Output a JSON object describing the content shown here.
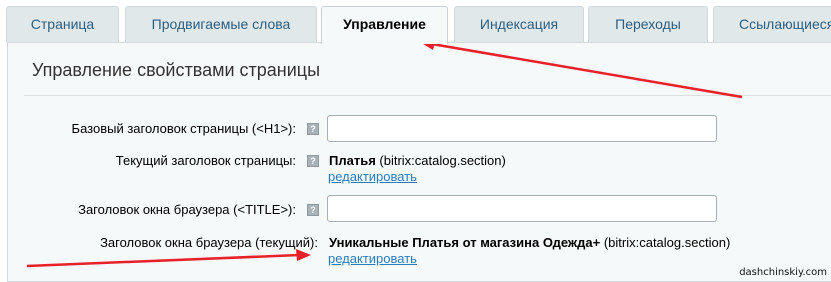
{
  "tabs": [
    {
      "label": "Страница",
      "active": false
    },
    {
      "label": "Продвигаемые слова",
      "active": false
    },
    {
      "label": "Управление",
      "active": true
    },
    {
      "label": "Индексация",
      "active": false
    },
    {
      "label": "Переходы",
      "active": false
    },
    {
      "label": "Ссылающиеся",
      "active": false
    }
  ],
  "panel": {
    "title": "Управление свойствами страницы",
    "rows": {
      "base_h1": {
        "label": "Базовый заголовок страницы (<H1>):",
        "value": ""
      },
      "current_h1": {
        "label": "Текущий заголовок страницы:",
        "value_bold": "Платья",
        "value_suffix": " (bitrix:catalog.section)",
        "edit_link": "редактировать"
      },
      "title": {
        "label": "Заголовок окна браузера (<TITLE>):",
        "value": ""
      },
      "current_title": {
        "label": "Заголовок окна браузера (текущий):",
        "value_bold": "Уникальные Платья от магазина Одежда+",
        "value_suffix": " (bitrix:catalog.section)",
        "edit_link": "редактировать"
      }
    },
    "help_glyph": "?"
  },
  "watermark": "dashchinskiy.com",
  "annotation_color": "#e8202a"
}
